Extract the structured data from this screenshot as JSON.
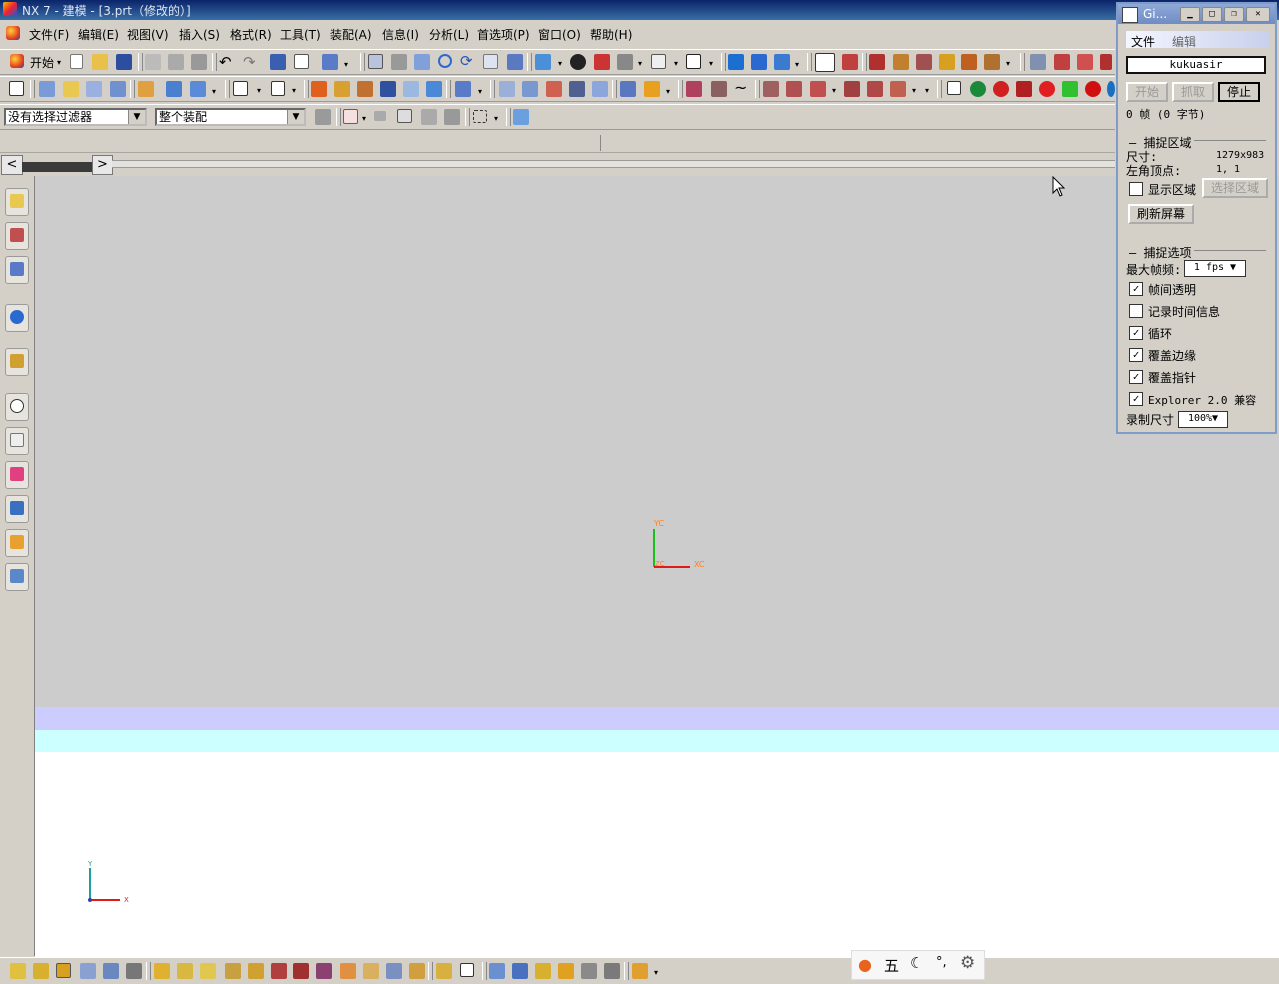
{
  "window": {
    "title": "NX 7 - 建模 - [3.prt（修改的）]"
  },
  "menu": [
    "文件(F)",
    "编辑(E)",
    "视图(V)",
    "插入(S)",
    "格式(R)",
    "工具(T)",
    "装配(A)",
    "信息(I)",
    "分析(L)",
    "首选项(P)",
    "窗口(O)",
    "帮助(H)"
  ],
  "toolbar": {
    "start_label": "开始"
  },
  "filters": {
    "selection_filter": "没有选择过滤器",
    "assembly_scope": "整个装配"
  },
  "viewport": {
    "wcs": {
      "y": "YC",
      "x": "XC",
      "origin": "ZC"
    },
    "abs_csys": {
      "y": "Y",
      "x": "X"
    }
  },
  "gif_panel": {
    "title": "Gi...",
    "menu": [
      "文件",
      "编辑"
    ],
    "author": "kukuasir",
    "buttons": {
      "start": "开始",
      "capture": "抓取",
      "stop": "停止"
    },
    "frames": "0 帧 (0 字节)",
    "capture_area": {
      "heading": "捕捉区域",
      "size_label": "尺寸:",
      "size_value": "1279x983",
      "corner_label": "左角顶点:",
      "corner_value": "1, 1",
      "show_area": "显示区域",
      "select_area": "选择区域",
      "refresh": "刷新屏幕"
    },
    "capture_options": {
      "heading": "捕捉选项",
      "max_fps_label": "最大帧频:",
      "max_fps_value": "1 fps",
      "options": [
        {
          "label": "帧间透明",
          "checked": true
        },
        {
          "label": "记录时间信息",
          "checked": false
        },
        {
          "label": "循环",
          "checked": true
        },
        {
          "label": "覆盖边缘",
          "checked": true
        },
        {
          "label": "覆盖指针",
          "checked": true
        },
        {
          "label": "Explorer 2.0 兼容",
          "checked": true
        }
      ],
      "record_size_label": "录制尺寸",
      "record_size_value": "100%"
    }
  },
  "ime": {
    "mode_char": "五"
  }
}
